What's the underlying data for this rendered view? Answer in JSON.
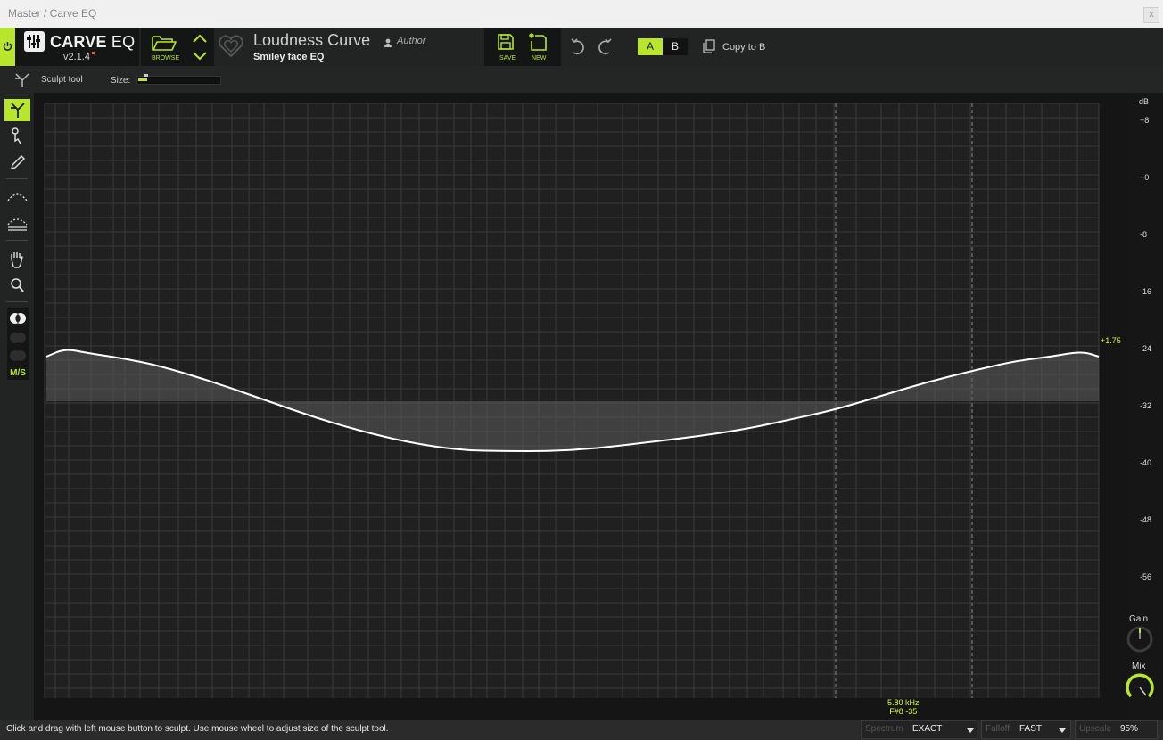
{
  "window": {
    "title": "Master / Carve EQ",
    "close_label": "x"
  },
  "header": {
    "logo_name": "CARVE",
    "logo_suffix": "EQ",
    "version": "v2.1.4",
    "browse_label": "BROWSE",
    "preset_name": "Loudness Curve",
    "preset_subtitle": "Smiley face EQ",
    "author": "Author",
    "save_label": "SAVE",
    "new_label": "NEW",
    "ab_a": "A",
    "ab_b": "B",
    "copy_label": "Copy to B",
    "accent_color": "#b8e62c"
  },
  "toolbar": {
    "tool_label": "Sculpt tool",
    "size_label": "Size:",
    "size_value": 0.1
  },
  "sidebar": {
    "tools": [
      "sculpt-icon",
      "pointer-icon",
      "pencil-icon",
      "curve-icon",
      "layered-curve-icon",
      "hand-icon",
      "magnifier-icon",
      "stereo-link-icon",
      "stereo-left-icon",
      "stereo-right-icon"
    ],
    "ms_label": "M/S"
  },
  "graph": {
    "db_unit": "dB",
    "db_ticks": [
      "+8",
      "+0",
      "-8",
      "-16",
      "-24",
      "-32",
      "-40",
      "-48",
      "-56"
    ],
    "curve_value": "+1.75",
    "readout_freq": "5.80 kHz",
    "readout_note": "F#8 -35",
    "gain_label": "Gain",
    "mix_label": "Mix",
    "gain_value": 0.5,
    "mix_value": 0.95
  },
  "status": {
    "message": "Click and drag with left mouse button to sculpt. Use mouse wheel to adjust size of the sculpt tool.",
    "spectrum_label": "Spectrum",
    "spectrum_value": "EXACT",
    "falloff_label": "Falloff",
    "falloff_value": "FAST",
    "upscale_label": "Upscale",
    "upscale_value": "95%"
  }
}
